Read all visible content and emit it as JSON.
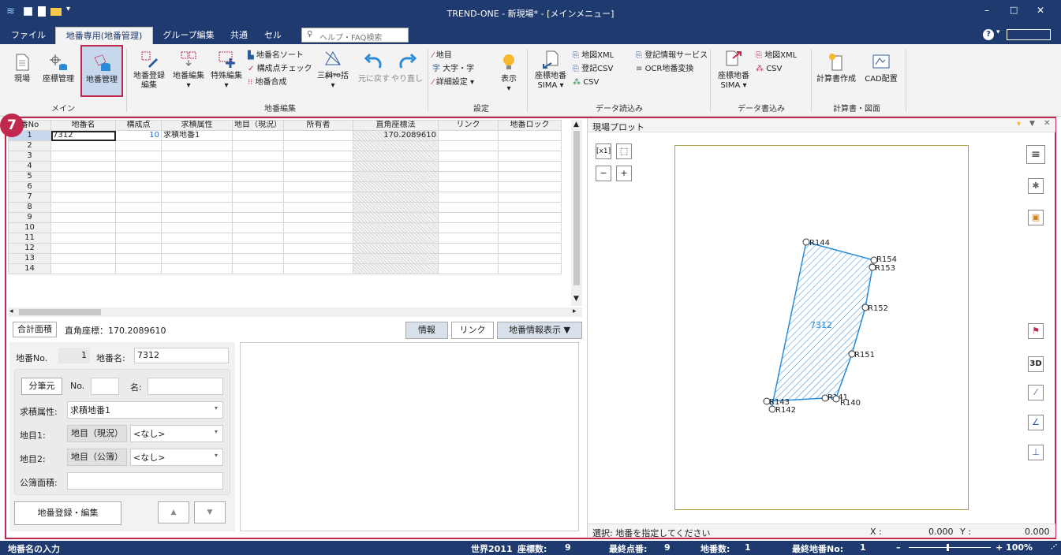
{
  "window": {
    "title": "TREND-ONE - 新現場* - [メインメニュー]"
  },
  "tabs": [
    {
      "label": "ファイル"
    },
    {
      "label": "地番専用(地番管理)"
    },
    {
      "label": "グループ編集"
    },
    {
      "label": "共通"
    },
    {
      "label": "セル"
    }
  ],
  "help_search": {
    "placeholder": "ヘルプ・FAQ検索"
  },
  "ribbon": {
    "main_group": {
      "label": "メイン",
      "genba": "現場",
      "zahyo": "座標管理",
      "chiban": "地番管理"
    },
    "edit_group": {
      "label": "地番編集",
      "register_line1": "地番登録",
      "register_line2": "編集",
      "chiban_edit": "地番編集",
      "special_edit": "特殊編集",
      "sort": "地番名ソート",
      "check": "構成点チェック",
      "merge": "地番合成",
      "auto": "AUTO",
      "sankaku": "三斜一括",
      "undo": "元に戻す",
      "redo": "やり直し"
    },
    "settings_group": {
      "label": "設定",
      "chimoku": "地目",
      "aza": "大字・字",
      "detail": "詳細設定",
      "display": "表示"
    },
    "read_group": {
      "label": "データ読込み",
      "sima_line1": "座標地番",
      "sima_line2": "SIMA",
      "xml": "地図XML",
      "touki_csv": "登記CSV",
      "csv": "CSV",
      "service": "登記情報サービス",
      "ocr": "OCR地番変換"
    },
    "write_group": {
      "label": "データ書込み",
      "sima_line1": "座標地番",
      "sima_line2": "SIMA",
      "xml": "地図XML",
      "csv": "CSV"
    },
    "calc_group": {
      "label": "計算書・図面",
      "calc": "計算書作成",
      "cad": "CAD配置"
    }
  },
  "step_badge": "7",
  "grid": {
    "columns": [
      "番No",
      "地番名",
      "構成点",
      "求積属性",
      "地目（現況）",
      "所有者",
      "直角座標法",
      "リンク",
      "地番ロック"
    ],
    "row_numbers": [
      "1",
      "2",
      "3",
      "4",
      "5",
      "6",
      "7",
      "8",
      "9",
      "10",
      "11",
      "12",
      "13",
      "14"
    ],
    "row1": {
      "name": "7312",
      "points": "10",
      "attr": "求積地番1",
      "area": "170.2089610"
    }
  },
  "info_panel": {
    "total_tab": "合計面積",
    "coord_text": "直角座標：170.2089610",
    "info_btn": "情報",
    "link_btn": "リンク",
    "display_btn": "地番情報表示 ▼"
  },
  "form": {
    "no_label": "地番No.",
    "no_value": "1",
    "name_label": "地番名:",
    "name_value": "7312",
    "bunpitsu_btn": "分筆元",
    "no2_label": "No.",
    "mei_label": "名:",
    "attr_label": "求積属性:",
    "attr_value": "求積地番1",
    "chimoku1_label": "地目1:",
    "chimoku1_type": "地目（現況）",
    "chimoku1_value": "<なし>",
    "chimoku2_label": "地目2:",
    "chimoku2_type": "地目（公簿）",
    "chimoku2_value": "<なし>",
    "koubo_label": "公簿面積:",
    "register_btn": "地番登録・編集",
    "up_btn": "▲",
    "down_btn": "▼"
  },
  "plot": {
    "title": "現場プロット",
    "parcel_label": "7312",
    "point_labels": [
      "R144",
      "R154",
      "R153",
      "R152",
      "R151",
      "R141",
      "R140",
      "R143",
      "R142"
    ],
    "status": "選択: 地番を指定してください",
    "x_label": "X :",
    "x_value": "0.000",
    "y_label": "Y :",
    "y_value": "0.000",
    "tool_3d": "3D",
    "tool_x1": "x1"
  },
  "statusbar": {
    "left": "地番名の入力",
    "world": "世界2011",
    "coord_count_label": "座標数:",
    "coord_count": "9",
    "last_point_label": "最終点番:",
    "last_point": "9",
    "parcel_count_label": "地番数:",
    "parcel_count": "1",
    "last_parcel_label": "最終地番No:",
    "last_parcel": "1",
    "zoom": "+ 100%"
  }
}
